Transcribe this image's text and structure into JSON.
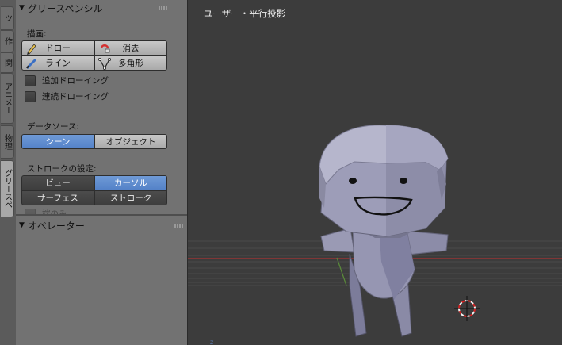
{
  "tabs": [
    "ツ",
    "作",
    "関",
    "アニメー",
    "物理",
    "グリースペ"
  ],
  "panel": {
    "title": "グリースペンシル",
    "draw_label": "描画:",
    "draw_buttons": [
      "ドロー",
      "消去",
      "ライン",
      "多角形"
    ],
    "checkboxes": [
      "追加ドローイング",
      "連続ドローイング"
    ],
    "data_source_label": "データソース:",
    "data_source_buttons": [
      "シーン",
      "オブジェクト"
    ],
    "stroke_label": "ストロークの設定:",
    "stroke_buttons": [
      "ビュー",
      "カーソル",
      "サーフェス",
      "ストローク"
    ],
    "endpoints_label": "端のみ"
  },
  "operator_panel": {
    "title": "オペレーター"
  },
  "viewport": {
    "title": "ユーザー・平行投影"
  },
  "icons": [
    "pencil-icon",
    "eraser-icon",
    "line-pen-icon",
    "polygon-icon",
    "cursor-3d-icon",
    "grip-icon"
  ],
  "colors": {
    "selected": "#5a88cc",
    "accent_cursor": "#d92020",
    "x_axis": "#a83232",
    "y_axis": "#5a8c3a"
  }
}
